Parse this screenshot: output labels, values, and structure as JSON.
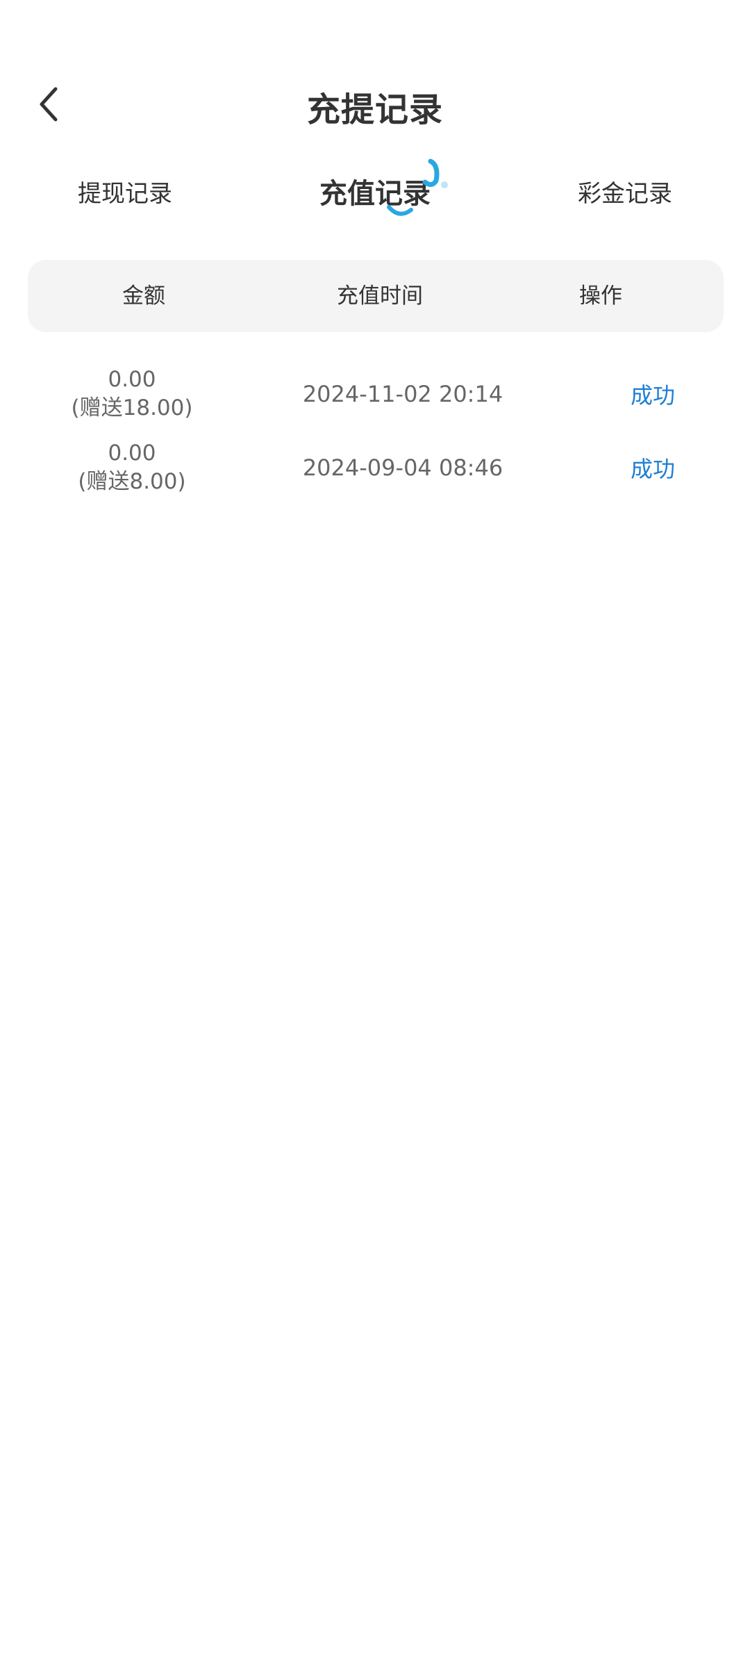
{
  "header": {
    "title": "充提记录"
  },
  "tabs": [
    {
      "label": "提现记录",
      "active": false
    },
    {
      "label": "充值记录",
      "active": true
    },
    {
      "label": "彩金记录",
      "active": false
    }
  ],
  "table": {
    "columns": [
      "金额",
      "充值时间",
      "操作"
    ],
    "rows": [
      {
        "amount": "0.00",
        "bonus": "(赠送18.00)",
        "time": "2024-11-02 20:14",
        "status": "成功"
      },
      {
        "amount": "0.00",
        "bonus": "(赠送8.00)",
        "time": "2024-09-04 08:46",
        "status": "成功"
      }
    ]
  },
  "colors": {
    "accent": "#1f7fd3",
    "indicator": "#29a8e0",
    "header_bg": "#f4f4f4"
  },
  "icons": {
    "back": "chevron-left-icon",
    "tab_indicator": "swirl-indicator-icon"
  }
}
